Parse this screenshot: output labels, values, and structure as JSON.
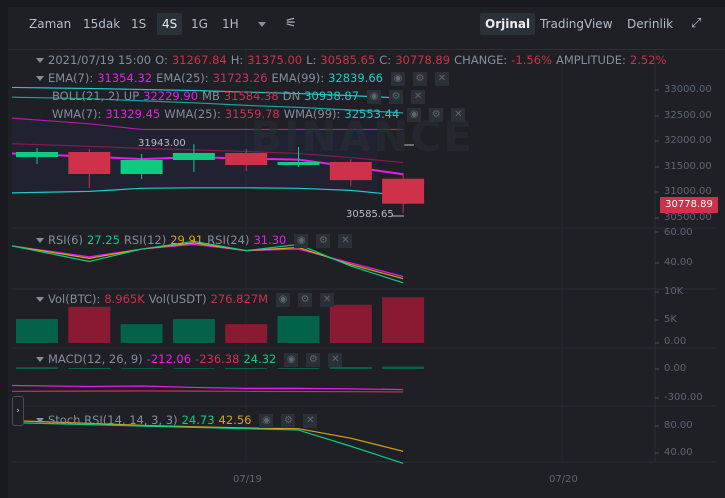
{
  "toolbar": {
    "intervals": [
      "Zaman",
      "15dak",
      "1S",
      "4S",
      "1G",
      "1H"
    ],
    "active_interval": "4S",
    "views": [
      "Orjinal",
      "TradingView",
      "Derinlik"
    ],
    "active_view": "Orjinal"
  },
  "ohlc": {
    "date": "2021/07/19 15:00",
    "o_label": "O:",
    "o": "31267.84",
    "h_label": "H:",
    "h": "31375.00",
    "l_label": "L:",
    "l": "30585.65",
    "c_label": "C:",
    "c": "30778.89",
    "change_label": "CHANGE:",
    "change": "-1.56%",
    "amp_label": "AMPLITUDE:",
    "amp": "2.52%"
  },
  "ema": {
    "l1": "EMA(7):",
    "v1": "31354.32",
    "l2": "EMA(25):",
    "v2": "31723.26",
    "l3": "EMA(99):",
    "v3": "32839.66"
  },
  "boll": {
    "l1": "BOLL(21, 2)",
    "l2": "UP",
    "v1": "32229.90",
    "l3": "MB",
    "v2": "31584.38",
    "l4": "DN",
    "v3": "30938.87"
  },
  "wma": {
    "l1": "WMA(7):",
    "v1": "31329.45",
    "l2": "WMA(25):",
    "v2": "31559.78",
    "l3": "WMA(99):",
    "v3": "32553.44"
  },
  "rsi": {
    "l1": "RSI(6)",
    "v1": "27.25",
    "l2": "RSI(12)",
    "v2": "29.91",
    "l3": "RSI(24)",
    "v3": "31.30"
  },
  "vol": {
    "l1": "Vol(BTC):",
    "v1": "8.965K",
    "l2": "Vol(USDT)",
    "v2": "276.827M"
  },
  "macd": {
    "l1": "MACD(12, 26, 9)",
    "v1": "-212.06",
    "v2": "-236.38",
    "v3": "24.32"
  },
  "stoch": {
    "l1": "Stoch RSI(14, 14, 3, 3)",
    "v1": "24.73",
    "v2": "42.56"
  },
  "price_axis": [
    "33000.00",
    "32500.00",
    "32000.00",
    "31500.00",
    "31000.00",
    "30500.00"
  ],
  "rsi_axis": [
    "60.00",
    "40.00"
  ],
  "vol_axis": [
    "10K",
    "5K",
    "0.00"
  ],
  "macd_axis": [
    "0.00",
    "-300.00"
  ],
  "stoch_axis": [
    "80.00",
    "40.00"
  ],
  "time_axis": [
    "07/19",
    "07/20"
  ],
  "last_price": "30778.89",
  "high_marker": "31943.00",
  "low_marker": "30585.65",
  "watermark": "BINANCE",
  "colors": {
    "up": "#0ecb81",
    "down": "#cf304a",
    "magenta": "#e91ee9",
    "cyan": "#1ec9c9",
    "yellow": "#d6a31a"
  },
  "candles": [
    {
      "o": 31691,
      "h": 31867,
      "l": 31555,
      "c": 31789,
      "vol": 4.7
    },
    {
      "o": 31789,
      "h": 31848,
      "l": 31086,
      "c": 31359,
      "vol": 7.1
    },
    {
      "o": 31359,
      "h": 31750,
      "l": 31262,
      "c": 31633,
      "vol": 3.7
    },
    {
      "o": 31633,
      "h": 31943,
      "l": 31398,
      "c": 31770,
      "vol": 4.7
    },
    {
      "o": 31770,
      "h": 31848,
      "l": 31418,
      "c": 31535,
      "vol": 3.7
    },
    {
      "o": 31535,
      "h": 31887,
      "l": 31496,
      "c": 31594,
      "vol": 5.3
    },
    {
      "o": 31594,
      "h": 31652,
      "l": 31125,
      "c": 31240,
      "vol": 7.5
    },
    {
      "o": 31267.84,
      "h": 31375,
      "l": 30585.65,
      "c": 30778.89,
      "vol": 8.965
    }
  ],
  "overlays": {
    "ema7": [
      31760,
      31700,
      31650,
      31690,
      31660,
      31640,
      31500,
      31354
    ],
    "boll_up": [
      32450,
      32340,
      32230,
      32230,
      32230,
      32230,
      32230,
      32230
    ],
    "boll_mb": [
      31950,
      31900,
      31860,
      31830,
      31800,
      31760,
      31680,
      31584
    ],
    "boll_dn": [
      30990,
      31020,
      31080,
      31090,
      31090,
      31080,
      31040,
      30939
    ],
    "ema99": [
      33050,
      33030,
      33010,
      32990,
      32960,
      32930,
      32890,
      32840
    ],
    "wma99": [
      32860,
      32830,
      32790,
      32750,
      32700,
      32660,
      32610,
      32553
    ]
  },
  "rsi_series": {
    "rsi6": [
      51,
      41,
      49,
      54,
      48,
      52,
      38,
      27.25
    ],
    "rsi12": [
      51,
      43,
      49,
      53,
      48,
      50,
      39,
      29.91
    ],
    "rsi24": [
      51,
      44,
      49,
      52,
      48,
      49,
      40,
      31.3
    ]
  },
  "macd_series": {
    "hist": [
      18,
      10,
      8,
      8,
      10,
      10,
      20,
      24.32
    ],
    "dif": [
      -170,
      -180,
      -175,
      -190,
      -200,
      -200,
      -205,
      -212.06
    ],
    "dea": [
      -230,
      -228,
      -226,
      -228,
      -230,
      -232,
      -234,
      -236.38
    ]
  },
  "stoch_series": {
    "k": [
      85,
      82,
      80,
      78,
      76,
      74,
      50,
      24.73
    ],
    "d": [
      88,
      84,
      81,
      79,
      77,
      76,
      62,
      42.56
    ]
  }
}
